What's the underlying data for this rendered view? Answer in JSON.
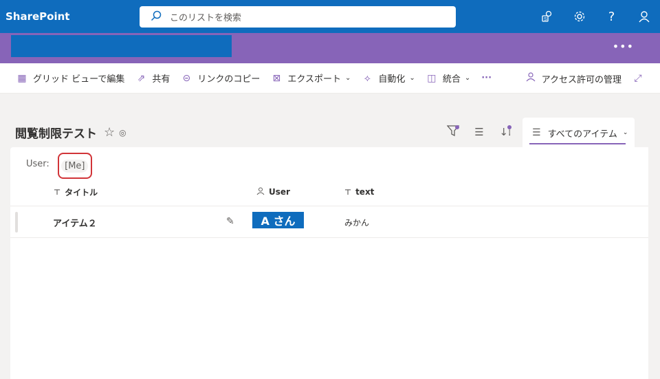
{
  "suitebar": {
    "brand": "SharePoint",
    "search_placeholder": "このリストを検索",
    "icons": [
      "sharepoint-app-icon",
      "settings-icon",
      "help-icon",
      "account-icon"
    ]
  },
  "commands": {
    "grid_edit": "グリッド ビューで編集",
    "share": "共有",
    "copy_link": "リンクのコピー",
    "export": "エクスポート",
    "automate": "自動化",
    "integrate": "統合",
    "more": "···",
    "manage_access": "アクセス許可の管理"
  },
  "list": {
    "title": "閲覧制限テスト",
    "view_name": "すべてのアイテム"
  },
  "filter": {
    "label": "User:",
    "value": "[Me]"
  },
  "columns": {
    "title": "タイトル",
    "user": "User",
    "text": "text"
  },
  "rows": [
    {
      "title": "アイテム２",
      "user": "A さん",
      "text": "みかん"
    }
  ],
  "colors": {
    "suitebar": "#0f6cbd",
    "site_header": "#8764b8",
    "accent": "#8764b8",
    "highlight_border": "#d13438"
  }
}
